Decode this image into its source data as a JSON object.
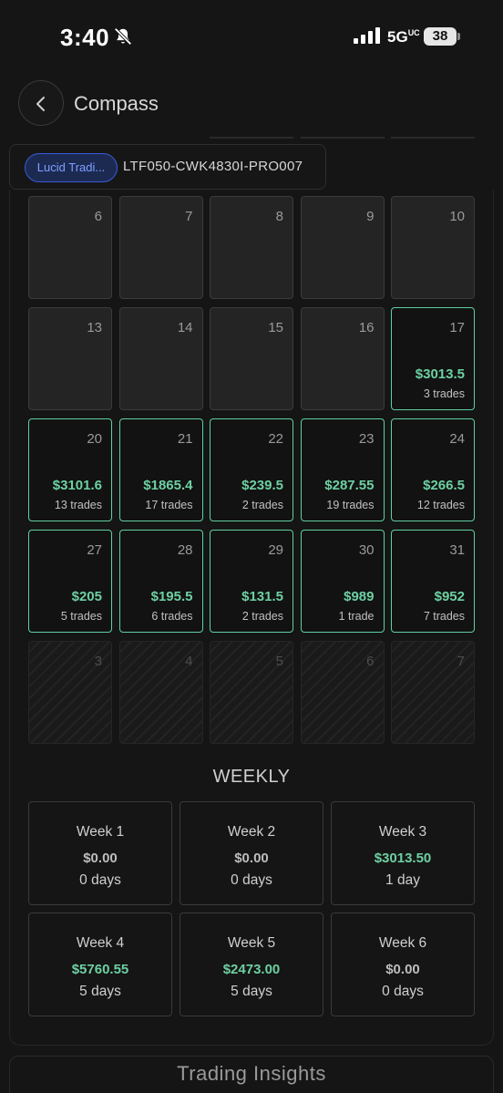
{
  "status_bar": {
    "time": "3:40",
    "network": "5G",
    "network_suffix": "UC",
    "battery": "38"
  },
  "header": {
    "title": "Compass"
  },
  "account": {
    "tag": "Lucid Tradi...",
    "id": "LTF050-CWK4830I-PRO007"
  },
  "calendar": {
    "days": [
      {
        "day": "6",
        "pnl": "",
        "trades": "",
        "state": "empty"
      },
      {
        "day": "7",
        "pnl": "",
        "trades": "",
        "state": "empty"
      },
      {
        "day": "8",
        "pnl": "",
        "trades": "",
        "state": "empty"
      },
      {
        "day": "9",
        "pnl": "",
        "trades": "",
        "state": "empty"
      },
      {
        "day": "10",
        "pnl": "",
        "trades": "",
        "state": "empty"
      },
      {
        "day": "13",
        "pnl": "",
        "trades": "",
        "state": "empty"
      },
      {
        "day": "14",
        "pnl": "",
        "trades": "",
        "state": "empty"
      },
      {
        "day": "15",
        "pnl": "",
        "trades": "",
        "state": "empty"
      },
      {
        "day": "16",
        "pnl": "",
        "trades": "",
        "state": "empty"
      },
      {
        "day": "17",
        "pnl": "$3013.5",
        "trades": "3 trades",
        "state": "trade"
      },
      {
        "day": "20",
        "pnl": "$3101.6",
        "trades": "13 trades",
        "state": "trade"
      },
      {
        "day": "21",
        "pnl": "$1865.4",
        "trades": "17 trades",
        "state": "trade"
      },
      {
        "day": "22",
        "pnl": "$239.5",
        "trades": "2 trades",
        "state": "trade"
      },
      {
        "day": "23",
        "pnl": "$287.55",
        "trades": "19 trades",
        "state": "trade"
      },
      {
        "day": "24",
        "pnl": "$266.5",
        "trades": "12 trades",
        "state": "trade"
      },
      {
        "day": "27",
        "pnl": "$205",
        "trades": "5 trades",
        "state": "trade"
      },
      {
        "day": "28",
        "pnl": "$195.5",
        "trades": "6 trades",
        "state": "trade"
      },
      {
        "day": "29",
        "pnl": "$131.5",
        "trades": "2 trades",
        "state": "trade"
      },
      {
        "day": "30",
        "pnl": "$989",
        "trades": "1 trade",
        "state": "trade"
      },
      {
        "day": "31",
        "pnl": "$952",
        "trades": "7 trades",
        "state": "trade"
      },
      {
        "day": "3",
        "pnl": "",
        "trades": "",
        "state": "out"
      },
      {
        "day": "4",
        "pnl": "",
        "trades": "",
        "state": "out"
      },
      {
        "day": "5",
        "pnl": "",
        "trades": "",
        "state": "out"
      },
      {
        "day": "6",
        "pnl": "",
        "trades": "",
        "state": "out"
      },
      {
        "day": "7",
        "pnl": "",
        "trades": "",
        "state": "out"
      }
    ]
  },
  "weekly": {
    "title": "WEEKLY",
    "weeks": [
      {
        "label": "Week 1",
        "pnl": "$0.00",
        "days": "0 days",
        "positive": false
      },
      {
        "label": "Week 2",
        "pnl": "$0.00",
        "days": "0 days",
        "positive": false
      },
      {
        "label": "Week 3",
        "pnl": "$3013.50",
        "days": "1 day",
        "positive": true
      },
      {
        "label": "Week 4",
        "pnl": "$5760.55",
        "days": "5 days",
        "positive": true
      },
      {
        "label": "Week 5",
        "pnl": "$2473.00",
        "days": "5 days",
        "positive": true
      },
      {
        "label": "Week 6",
        "pnl": "$0.00",
        "days": "0 days",
        "positive": false
      }
    ]
  },
  "insights": {
    "label": "Trading Insights"
  },
  "colors": {
    "profit": "#6dd0a2",
    "accent_border": "#5fd0a0",
    "account_tag": "#3a5bd9",
    "background": "#151515"
  },
  "icons": {
    "back": "chevron-left-icon",
    "silent": "bell-slash-icon",
    "signal": "signal-bars-icon"
  }
}
